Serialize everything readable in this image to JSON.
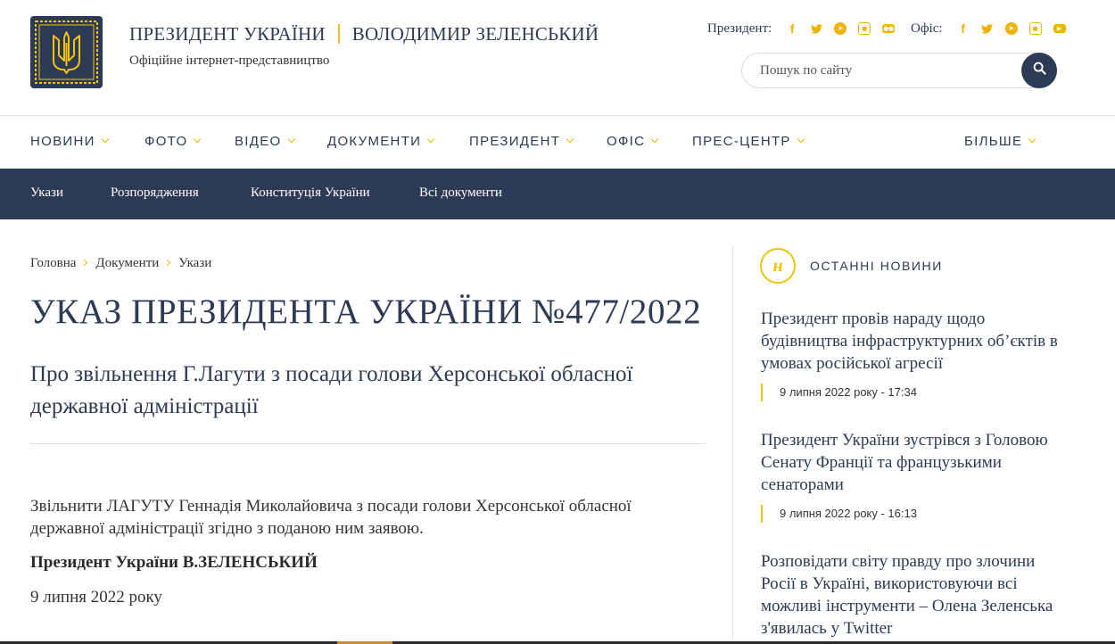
{
  "header": {
    "title_president": "ПРЕЗИДЕНТ УКРАЇНИ",
    "title_name": "ВОЛОДИМИР ЗЕЛЕНСЬКИЙ",
    "subtitle": "Офіційне інтернет-представництво",
    "social_president_label": "Президент:",
    "social_office_label": "Офіс:",
    "social_president_icons": [
      "facebook-icon",
      "twitter-icon",
      "telegram-icon",
      "instagram-icon",
      "flickr-icon"
    ],
    "social_office_icons": [
      "facebook-icon",
      "twitter-icon",
      "telegram-icon",
      "instagram-icon",
      "youtube-icon"
    ]
  },
  "search": {
    "placeholder": "Пошук по сайту"
  },
  "mainnav": [
    "НОВИНИ",
    "ФОТО",
    "ВІДЕО",
    "ДОКУМЕНТИ",
    "ПРЕЗИДЕНТ",
    "ОФІС",
    "ПРЕС-ЦЕНТР",
    "БІЛЬШЕ"
  ],
  "subnav": [
    "Укази",
    "Розпорядження",
    "Конституція України",
    "Всі документи"
  ],
  "breadcrumb": [
    "Головна",
    "Документи",
    "Укази"
  ],
  "document": {
    "title": "УКАЗ ПРЕЗИДЕНТА УКРАЇНИ №477/2022",
    "subtitle": "Про звільнення Г.Лагути з посади голови Херсонської обласної державної адміністрації",
    "body": "Звільнити ЛАГУТУ Геннадія Миколайовича з посади голови Херсонської обласної державної адміністрації згідно з поданою ним заявою.",
    "signature": "Президент України В.ЗЕЛЕНСЬКИЙ",
    "date": "9 липня 2022 року"
  },
  "sidebar": {
    "badge": "н",
    "heading": "ОСТАННІ НОВИНИ",
    "news": [
      {
        "title": "Президент провів нараду щодо будівництва інфраструктурних об’єктів в умовах російської агресії",
        "date": "9 липня 2022 року - 17:34"
      },
      {
        "title": "Президент України зустрівся з Головою Сенату Франції та французькими сенаторами",
        "date": "9 липня 2022 року - 16:13"
      },
      {
        "title": "Розповідати світу правду про злочини Росії в Україні, використовуючи всі можливі інструменти – Олена Зеленська з'явилась у Twitter",
        "date": ""
      }
    ]
  },
  "colors": {
    "navy": "#2c3a55",
    "gold": "#f0c30f",
    "icon_gold": "#f0b400"
  }
}
